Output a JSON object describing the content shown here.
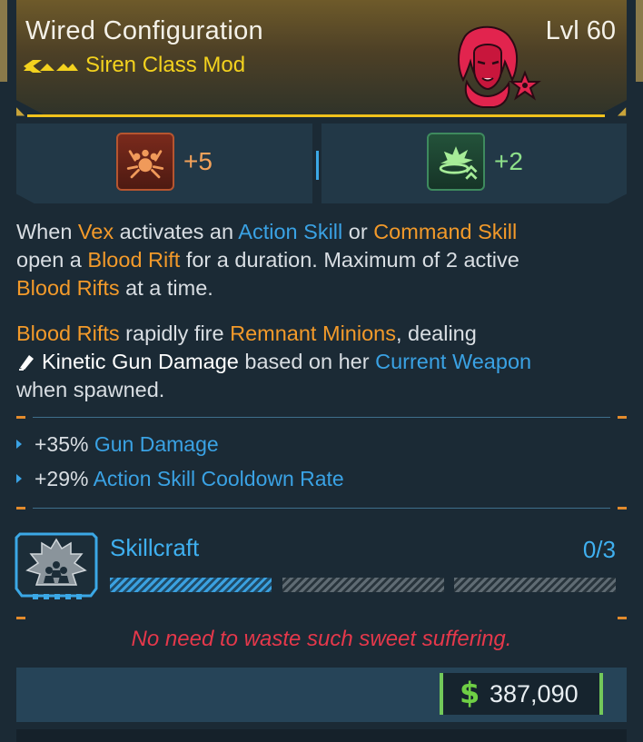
{
  "item": {
    "name": "Wired Configuration",
    "level": "Lvl 60",
    "type": "Siren Class Mod",
    "rarity_color": "#f3d21e",
    "portrait_icon": "vex-portrait-icon"
  },
  "skills": [
    {
      "icon": "paw-spider-skill-icon",
      "bonus": "+5",
      "color": "#f4a25a"
    },
    {
      "icon": "explosion-arrows-skill-icon",
      "bonus": "+2",
      "color": "#8ee08a"
    }
  ],
  "description": {
    "p1": {
      "s1": "When ",
      "h1": "Vex",
      "s2": " activates an ",
      "h2": "Action Skill",
      "s3": " or ",
      "h3": "Command Skill",
      "s4": "open a ",
      "h4": "Blood Rift",
      "s5": " for a duration. Maximum of 2 active",
      "h5": "Blood Rifts",
      "s6": " at a time."
    },
    "p2": {
      "h1": "Blood Rifts",
      "s1": " rapidly fire ",
      "h2": "Remnant Minions",
      "s2": ", dealing",
      "h3": "Kinetic Gun Damage",
      "s3": " based on her ",
      "h4": "Current Weapon",
      "s4": "when spawned."
    }
  },
  "stats": [
    {
      "value": "+35%",
      "label": "Gun Damage"
    },
    {
      "value": "+29%",
      "label": "Action Skill Cooldown Rate"
    }
  ],
  "skillcraft": {
    "label": "Skillcraft",
    "count": "0/3",
    "bars_filled": 1,
    "bars_total": 3
  },
  "flavor_text": "No need to waste such sweet suffering.",
  "price": {
    "symbol": "$",
    "value": "387,090"
  },
  "colors": {
    "orange_highlight": "#f39a2a",
    "blue_highlight": "#3aa2e4",
    "flavor_red": "#e5384b",
    "money_green": "#6fcf45"
  }
}
